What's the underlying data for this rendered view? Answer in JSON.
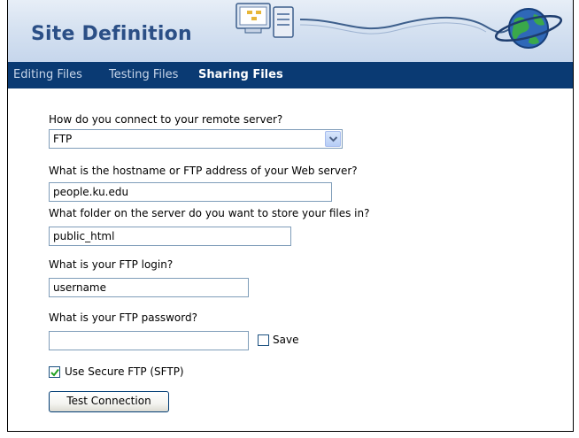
{
  "header": {
    "title": "Site Definition"
  },
  "tabs": [
    {
      "label": "Editing Files"
    },
    {
      "label": "Testing Files"
    },
    {
      "label": "Sharing Files"
    }
  ],
  "form": {
    "connect_question": "How do you connect to your remote server?",
    "connect_value": "FTP",
    "host_question": "What is the hostname or FTP address of your Web server?",
    "host_value": "people.ku.edu",
    "folder_question": "What folder on the server do you want to store your files in?",
    "folder_value": "public_html",
    "login_question": "What is your FTP login?",
    "login_value": "username",
    "password_question": "What is your FTP password?",
    "password_value": "",
    "save_label": "Save",
    "save_checked": false,
    "sftp_label": "Use Secure FTP (SFTP)",
    "sftp_checked": true,
    "test_button": "Test Connection"
  }
}
